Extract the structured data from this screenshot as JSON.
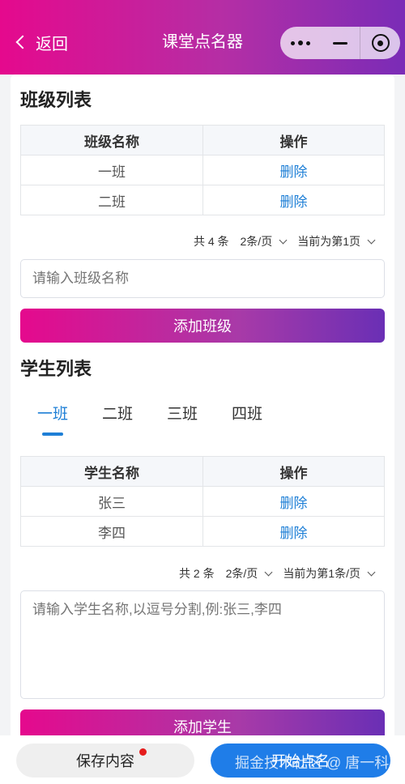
{
  "nav": {
    "back_label": "返回",
    "title": "课堂点名器"
  },
  "class_section": {
    "title": "班级列表",
    "headers": [
      "班级名称",
      "操作"
    ],
    "rows": [
      {
        "name": "一班",
        "action": "删除"
      },
      {
        "name": "二班",
        "action": "删除"
      }
    ],
    "pager": {
      "total": "共 4 条",
      "page_size": "2条/页",
      "current": "当前为第1页"
    },
    "input_placeholder": "请输入班级名称",
    "add_button": "添加班级"
  },
  "student_section": {
    "title": "学生列表",
    "tabs": [
      "一班",
      "二班",
      "三班",
      "四班"
    ],
    "active_tab": "一班",
    "headers": [
      "学生名称",
      "操作"
    ],
    "rows": [
      {
        "name": "张三",
        "action": "删除"
      },
      {
        "name": "李四",
        "action": "删除"
      }
    ],
    "pager": {
      "total": "共 2 条",
      "page_size": "2条/页",
      "current": "当前为第1条/页"
    },
    "textarea_placeholder": "请输入学生名称,以逗号分割,例:张三,李四",
    "add_button": "添加学生"
  },
  "bottom": {
    "save_label": "保存内容",
    "start_label": "开始点名",
    "watermark": "掘金技术社区 @ 唐一科"
  },
  "colors": {
    "gradient_start": "#e5098d",
    "gradient_end": "#7a2cb7",
    "link_blue": "#1e7fd6",
    "primary_button": "#1f7de8",
    "badge_red": "#e51c1c"
  },
  "icons": [
    "back-chevron-icon",
    "more-dots-icon",
    "minimize-icon",
    "close-target-icon",
    "chevron-down-icon"
  ]
}
